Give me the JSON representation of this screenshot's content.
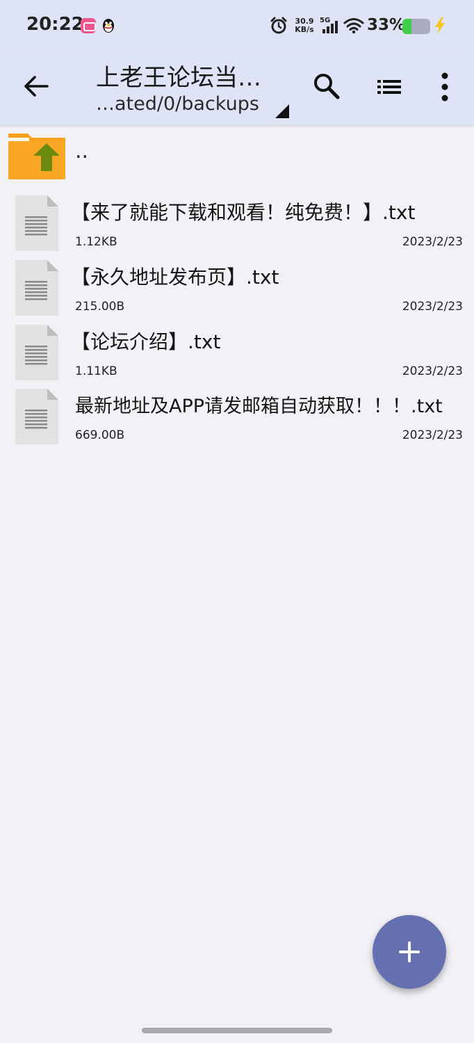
{
  "status_bar": {
    "time": "20:22",
    "net_speed_value": "30.9",
    "net_speed_unit": "KB/s",
    "network_type": "5G",
    "battery_percent": "33%",
    "battery_level": 0.33,
    "icons": [
      "bilibili-app-icon",
      "qq-icon",
      "alarm-icon",
      "signal-icon",
      "wifi-icon",
      "battery-icon",
      "charging-icon"
    ]
  },
  "toolbar": {
    "title": "上老王论坛当…",
    "path": "…ated/0/backups",
    "icons": [
      "back-arrow-icon",
      "search-icon",
      "list-view-icon",
      "more-vert-icon"
    ],
    "accent_color": "#dfe3f6"
  },
  "parent_dir": {
    "label": ".."
  },
  "files": [
    {
      "name": "【来了就能下载和观看！纯免费！】.txt",
      "size": "1.12KB",
      "date": "2023/2/23"
    },
    {
      "name": "【永久地址发布页】.txt",
      "size": "215.00B",
      "date": "2023/2/23"
    },
    {
      "name": "【论坛介绍】.txt",
      "size": "1.11KB",
      "date": "2023/2/23"
    },
    {
      "name": "最新地址及APP请发邮箱自动获取！！！.txt",
      "size": "669.00B",
      "date": "2023/2/23"
    }
  ],
  "fab": {
    "icon": "plus-icon",
    "color": "#6470b0"
  }
}
